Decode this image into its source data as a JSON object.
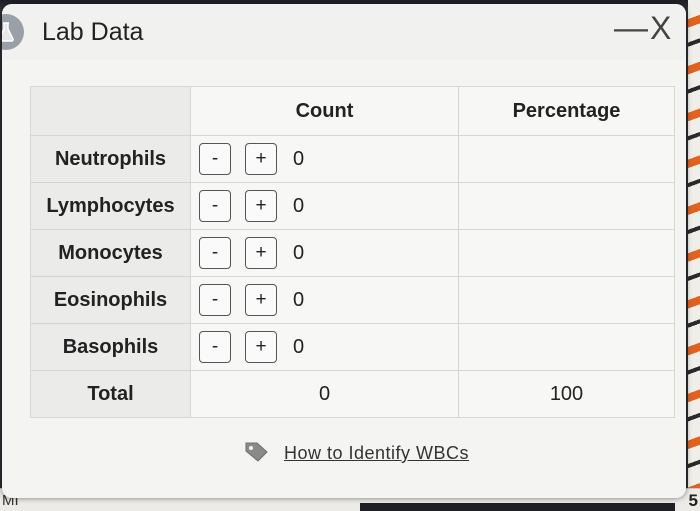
{
  "window": {
    "title": "Lab Data",
    "minimize_glyph": "—",
    "close_glyph": "X"
  },
  "table": {
    "headers": [
      "",
      "Count",
      "Percentage"
    ],
    "rows": [
      {
        "label": "Neutrophils",
        "count": "0",
        "percentage": ""
      },
      {
        "label": "Lymphocytes",
        "count": "0",
        "percentage": ""
      },
      {
        "label": "Monocytes",
        "count": "0",
        "percentage": ""
      },
      {
        "label": "Eosinophils",
        "count": "0",
        "percentage": ""
      },
      {
        "label": "Basophils",
        "count": "0",
        "percentage": ""
      }
    ],
    "decrement_label": "-",
    "increment_label": "+",
    "total": {
      "label": "Total",
      "count": "0",
      "percentage": "100"
    }
  },
  "help_link": {
    "label": "How to Identify WBCs",
    "icon": "tag-icon"
  },
  "background": {
    "left_text": "MI",
    "right_text": "5"
  }
}
